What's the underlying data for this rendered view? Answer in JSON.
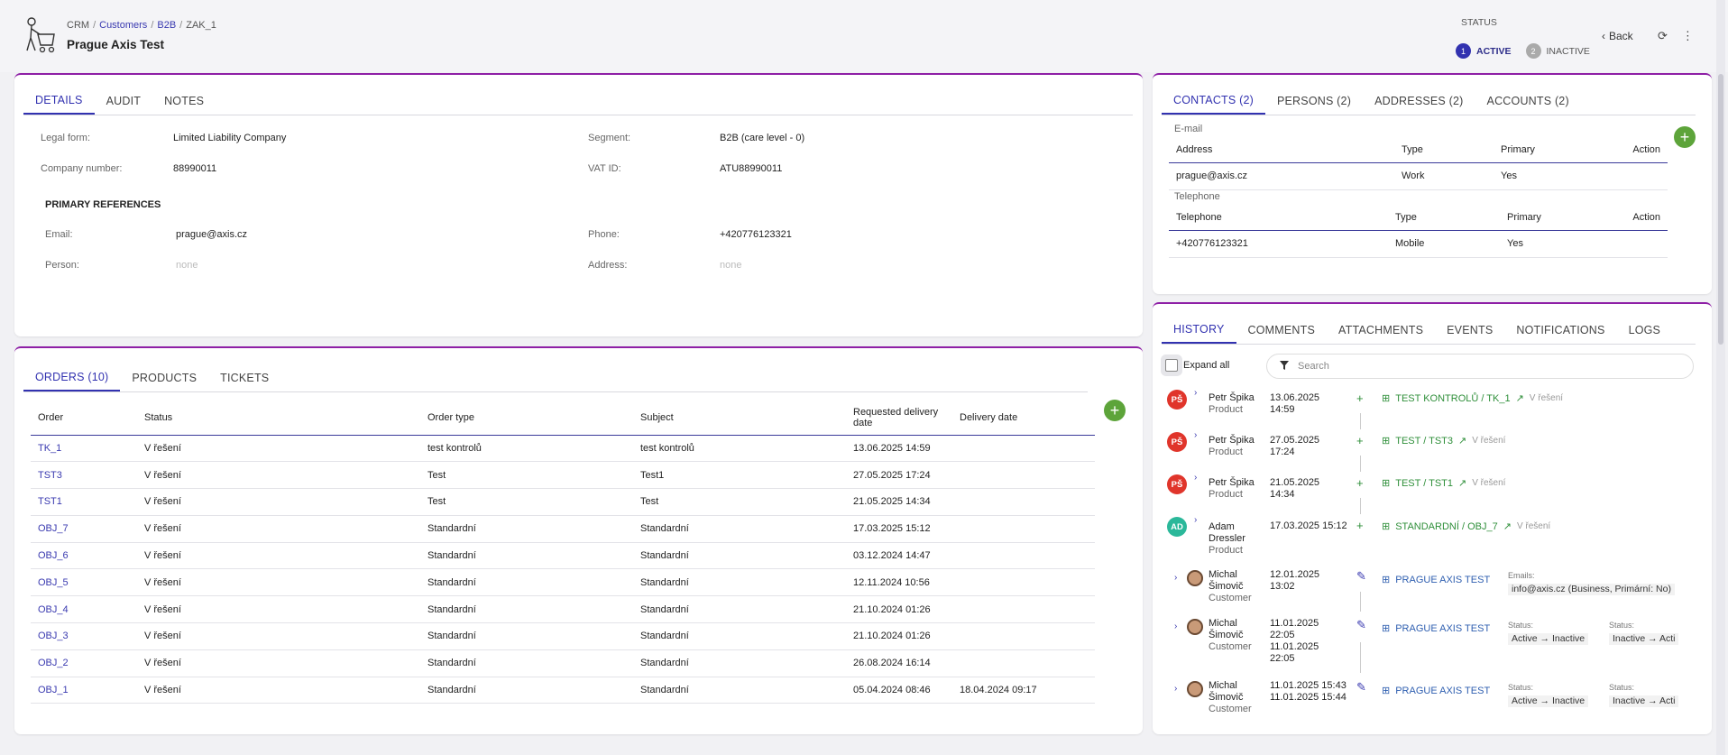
{
  "header": {
    "breadcrumb": [
      "CRM",
      "Customers",
      "B2B",
      "ZAK_1"
    ],
    "title": "Prague Axis Test",
    "status_label": "STATUS",
    "steps": [
      {
        "num": "1",
        "label": "ACTIVE"
      },
      {
        "num": "2",
        "label": "INACTIVE"
      }
    ],
    "back_label": "Back"
  },
  "details": {
    "tabs": [
      "DETAILS",
      "AUDIT",
      "NOTES"
    ],
    "legal_form_label": "Legal form:",
    "legal_form": "Limited Liability Company",
    "segment_label": "Segment:",
    "segment": "B2B (care level - 0)",
    "company_number_label": "Company number:",
    "company_number": "88990011",
    "vat_label": "VAT ID:",
    "vat": "ATU88990011",
    "primary_refs": "PRIMARY REFERENCES",
    "email_label": "Email:",
    "email": "prague@axis.cz",
    "phone_label": "Phone:",
    "phone": "+420776123321",
    "person_label": "Person:",
    "person": "none",
    "address_label": "Address:",
    "address": "none"
  },
  "orders": {
    "tabs": [
      "ORDERS (10)",
      "PRODUCTS",
      "TICKETS"
    ],
    "columns": [
      "Order",
      "Status",
      "Order type",
      "Subject",
      "Requested delivery date",
      "Delivery date"
    ],
    "rows": [
      [
        "TK_1",
        "V řešení",
        "test kontrolů",
        "test kontrolů",
        "13.06.2025 14:59",
        ""
      ],
      [
        "TST3",
        "V řešení",
        "Test",
        "Test1",
        "27.05.2025 17:24",
        ""
      ],
      [
        "TST1",
        "V řešení",
        "Test",
        "Test",
        "21.05.2025 14:34",
        ""
      ],
      [
        "OBJ_7",
        "V řešení",
        "Standardní",
        "Standardní",
        "17.03.2025 15:12",
        ""
      ],
      [
        "OBJ_6",
        "V řešení",
        "Standardní",
        "Standardní",
        "03.12.2024 14:47",
        ""
      ],
      [
        "OBJ_5",
        "V řešení",
        "Standardní",
        "Standardní",
        "12.11.2024 10:56",
        ""
      ],
      [
        "OBJ_4",
        "V řešení",
        "Standardní",
        "Standardní",
        "21.10.2024 01:26",
        ""
      ],
      [
        "OBJ_3",
        "V řešení",
        "Standardní",
        "Standardní",
        "21.10.2024 01:26",
        ""
      ],
      [
        "OBJ_2",
        "V řešení",
        "Standardní",
        "Standardní",
        "26.08.2024 16:14",
        ""
      ],
      [
        "OBJ_1",
        "V řešení",
        "Standardní",
        "Standardní",
        "05.04.2024 08:46",
        "18.04.2024 09:17"
      ]
    ]
  },
  "contacts": {
    "tabs": [
      "CONTACTS (2)",
      "PERSONS (2)",
      "ADDRESSES (2)",
      "ACCOUNTS (2)"
    ],
    "email_section": "E-mail",
    "email_cols": [
      "Address",
      "Type",
      "Primary",
      "Action"
    ],
    "email_row": [
      "prague@axis.cz",
      "Work",
      "Yes"
    ],
    "phone_section": "Telephone",
    "phone_cols": [
      "Telephone",
      "Type",
      "Primary",
      "Action"
    ],
    "phone_row": [
      "+420776123321",
      "Mobile",
      "Yes"
    ]
  },
  "history": {
    "tabs": [
      "HISTORY",
      "COMMENTS",
      "ATTACHMENTS",
      "EVENTS",
      "NOTIFICATIONS",
      "LOGS"
    ],
    "expand_all": "Expand all",
    "search_placeholder": "Search",
    "items": [
      {
        "initials": "PŠ",
        "name": "Petr Špika",
        "role": "Product",
        "date1": "13.06.2025",
        "date2": "14:59",
        "link": "TEST KONTROLŮ / TK_1",
        "state": "V řešení"
      },
      {
        "initials": "PŠ",
        "name": "Petr Špika",
        "role": "Product",
        "date1": "27.05.2025",
        "date2": "17:24",
        "link": "TEST / TST3",
        "state": "V řešení"
      },
      {
        "initials": "PŠ",
        "name": "Petr Špika",
        "role": "Product",
        "date1": "21.05.2025",
        "date2": "14:34",
        "link": "TEST / TST1",
        "state": "V řešení"
      },
      {
        "initials": "AD",
        "name1": "Adam",
        "name2": "Dressler",
        "role": "Product",
        "date1": "17.03.2025 15:12",
        "link": "STANDARDNÍ / OBJ_7",
        "state": "V řešení"
      },
      {
        "name1": "Michal",
        "name2": "Šimovič",
        "role": "Customer",
        "date1": "12.01.2025",
        "date2": "13:02",
        "link": "PRAGUE AXIS TEST",
        "meta_label": "Emails:",
        "meta_value": "info@axis.cz (Business, Primární: No)"
      },
      {
        "name1": "Michal",
        "name2": "Šimovič",
        "role": "Customer",
        "date1": "11.01.2025",
        "date2": "22:05",
        "date3": "11.01.2025",
        "date4": "22:05",
        "link": "PRAGUE AXIS TEST",
        "meta_label": "Status:",
        "meta_from": "Active",
        "meta_to": "Inactive",
        "meta2_label": "Status:",
        "meta2_from": "Inactive",
        "meta2_to": "Acti"
      },
      {
        "name1": "Michal",
        "name2": "Šimovič",
        "role": "Customer",
        "date1": "11.01.2025 15:43",
        "date2": "11.01.2025 15:44",
        "link": "PRAGUE AXIS TEST",
        "meta_label": "Status:",
        "meta_from": "Active",
        "meta_to": "Inactive",
        "meta2_label": "Status:",
        "meta2_from": "Inactive",
        "meta2_to": "Acti"
      }
    ]
  },
  "colors": {
    "accent": "#3232b0",
    "panel_border": "#8e1fa6",
    "add": "#5da43a",
    "avatar_red": "#e0352b",
    "avatar_teal": "#2bb89a"
  }
}
